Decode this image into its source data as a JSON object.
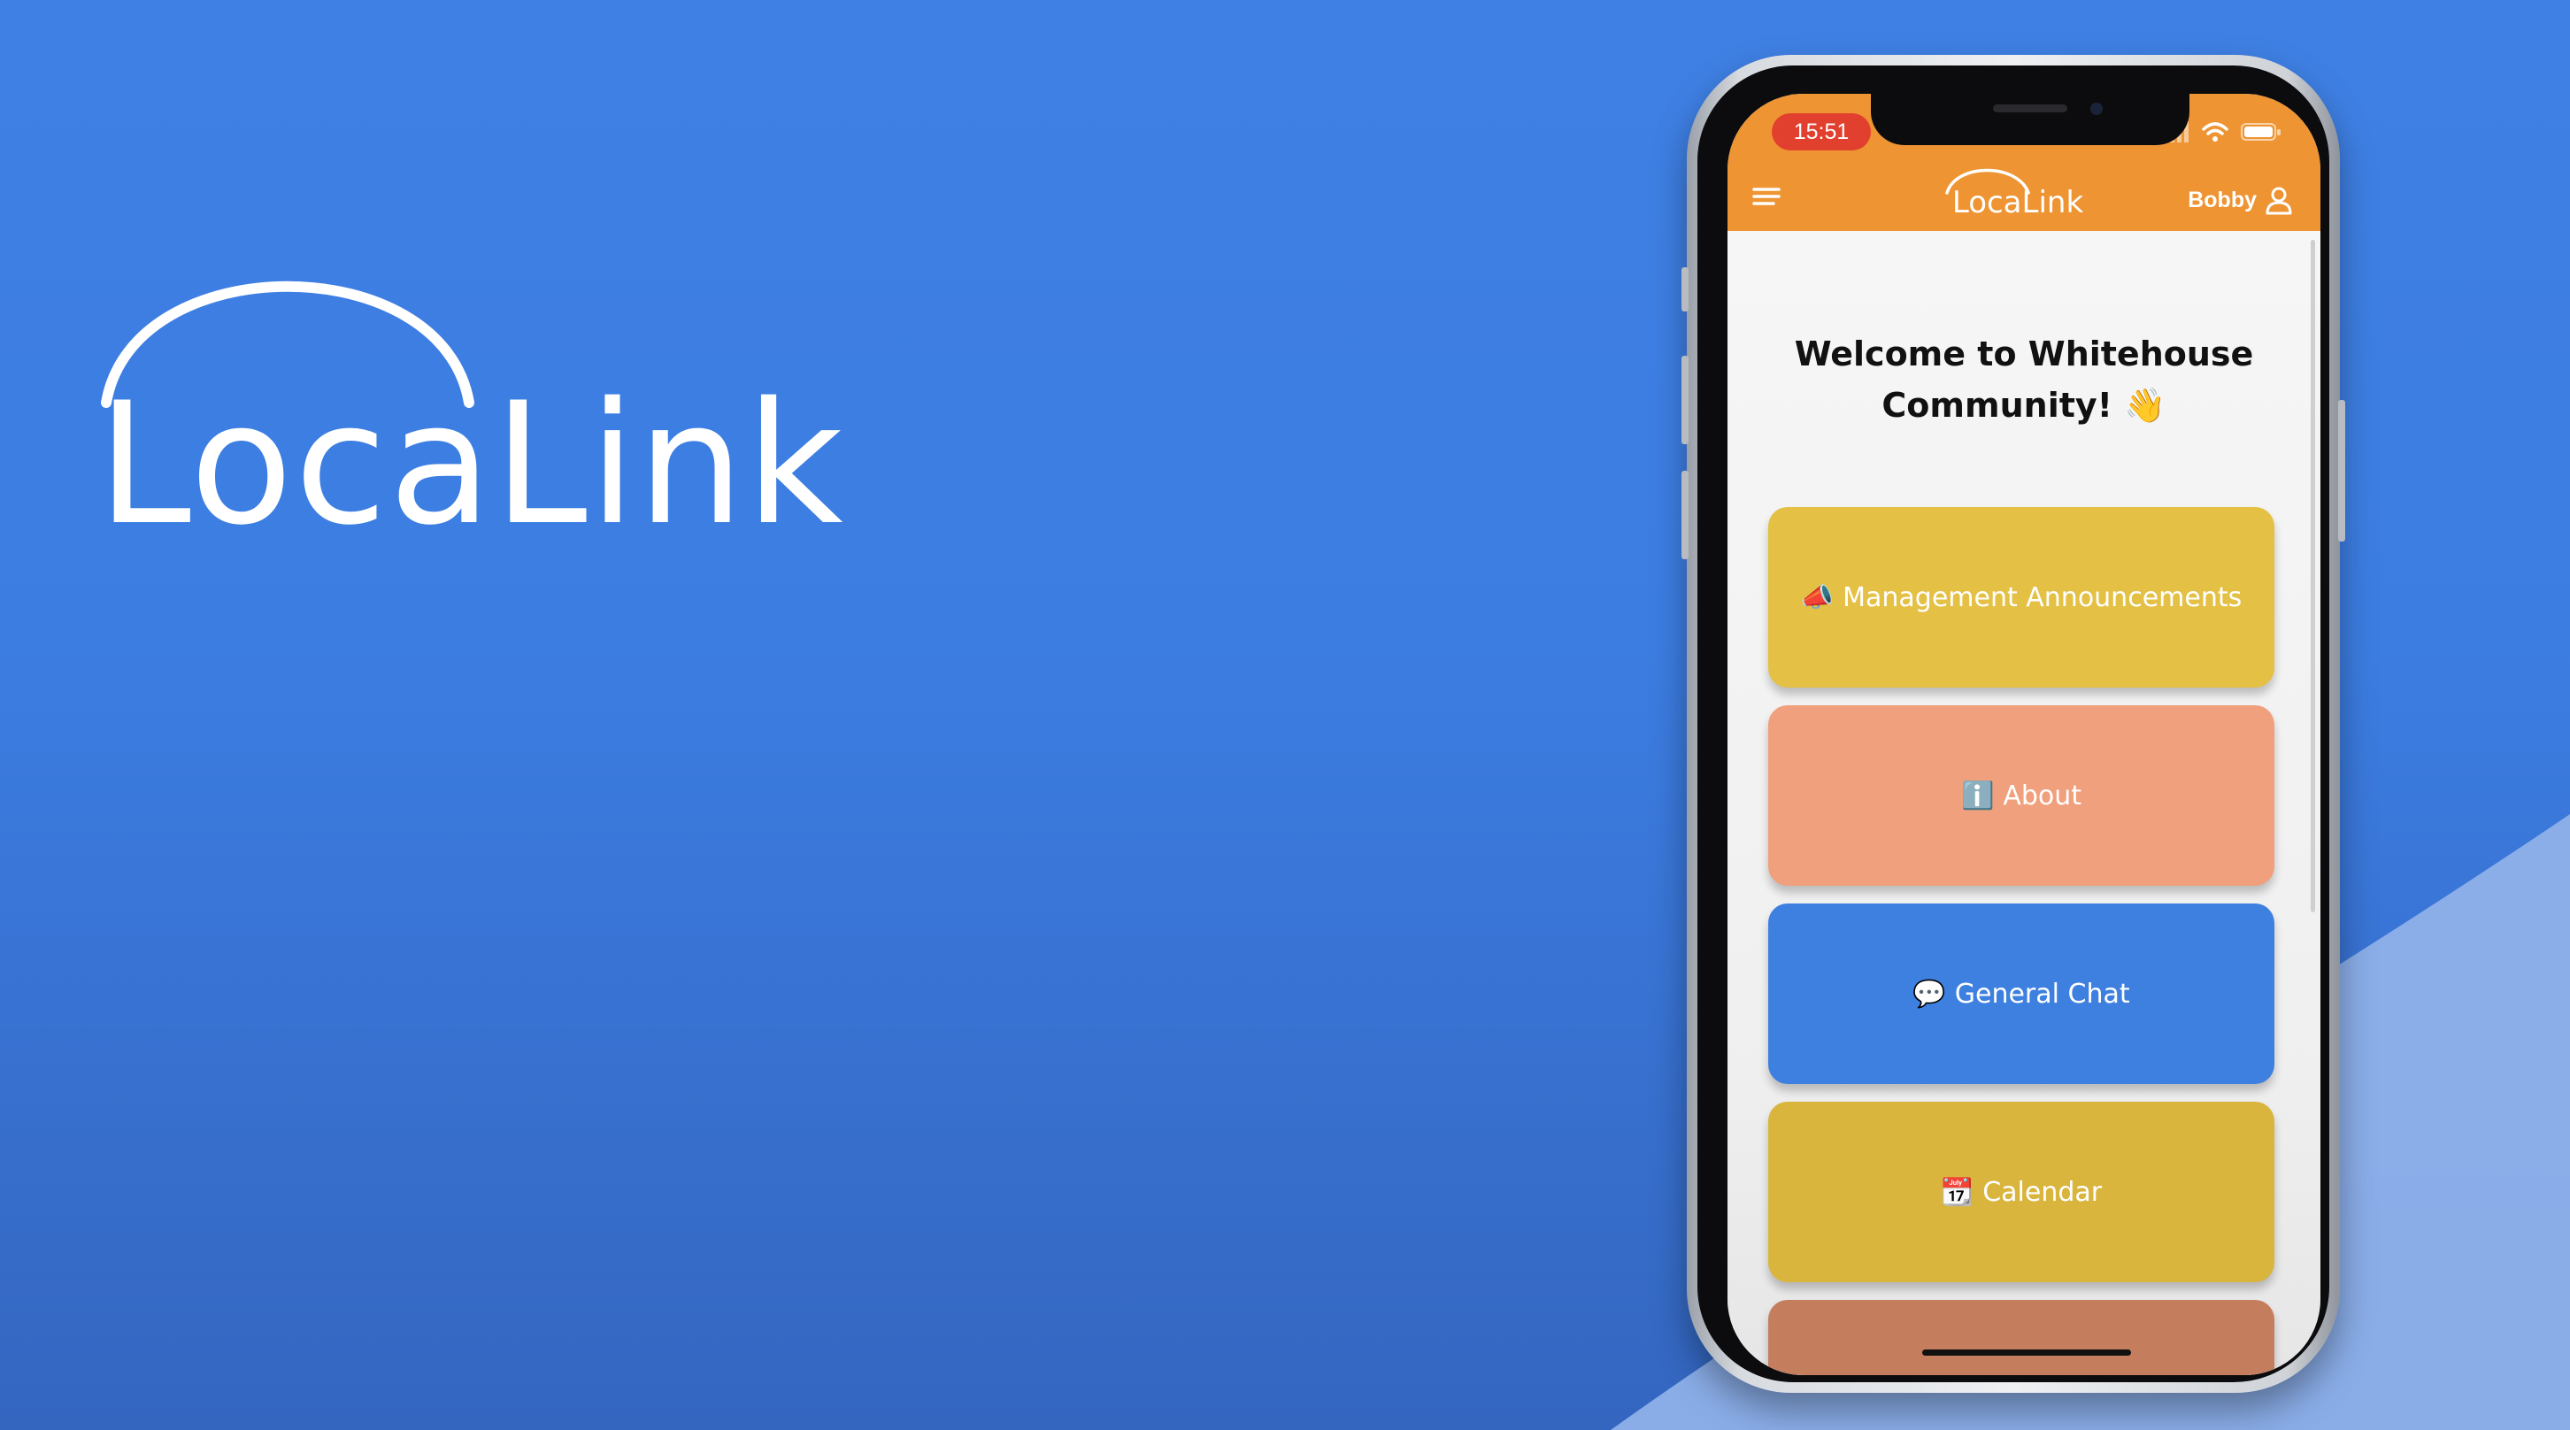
{
  "brand": {
    "name": "LocaLink"
  },
  "phone": {
    "status_bar": {
      "time": "15:51"
    },
    "header": {
      "menu_icon": "hamburger-menu-icon",
      "logo_text": "LocaLink",
      "user_name": "Bobby",
      "user_icon": "user-icon"
    },
    "welcome": {
      "line1": "Welcome to Whitehouse",
      "line2": "Community! 👋"
    },
    "tiles": [
      {
        "icon": "📣",
        "label": "Management Announcements",
        "color": "#e4c044"
      },
      {
        "icon": "ℹ️",
        "label": "About",
        "color": "#f0a07d"
      },
      {
        "icon": "💬",
        "label": "General Chat",
        "color": "#3e80e0"
      },
      {
        "icon": "📆",
        "label": "Calendar",
        "color": "#d9b53e"
      },
      {
        "icon": "",
        "label": "",
        "color": "#c47e5e"
      }
    ]
  },
  "colors": {
    "background": "#3f80e4",
    "header_orange": "#ee9433",
    "status_time_red": "#e2402e"
  }
}
